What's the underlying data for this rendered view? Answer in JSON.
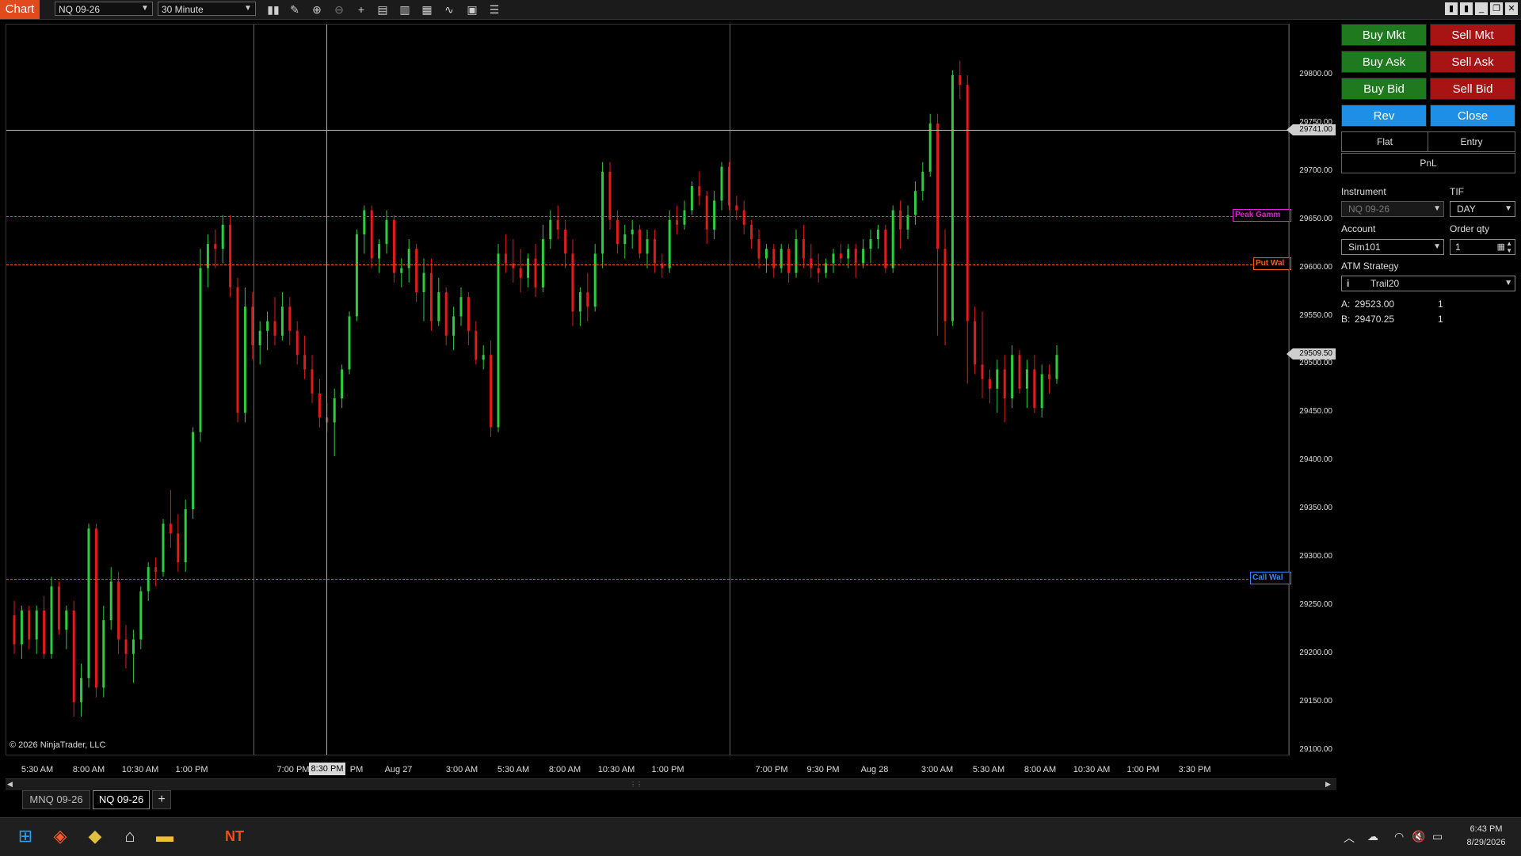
{
  "titlebar": {
    "app_title": "Chart",
    "instrument": "NQ 09-26",
    "interval": "30 Minute"
  },
  "chart": {
    "copyright": "© 2026 NinjaTrader, LLC",
    "y_ticks": [
      "29800.00",
      "29750.00",
      "29700.00",
      "29650.00",
      "29600.00",
      "29550.00",
      "29500.00",
      "29450.00",
      "29400.00",
      "29350.00",
      "29300.00",
      "29250.00",
      "29200.00",
      "29150.00",
      "29100.00"
    ],
    "x_labels": [
      "5:30 AM",
      "8:00 AM",
      "10:30 AM",
      "1:00 PM",
      "7:00 PM",
      "8:30 PM",
      "PM",
      "Aug 27",
      "3:00 AM",
      "5:30 AM",
      "8:00 AM",
      "10:30 AM",
      "1:00 PM",
      "7:00 PM",
      "9:30 PM",
      "Aug 28",
      "3:00 AM",
      "5:30 AM",
      "8:00 AM",
      "10:30 AM",
      "1:00 PM",
      "3:30 PM"
    ],
    "crosshair_price": "29741.00",
    "last_price": "29509.50",
    "levels": {
      "peak_gamma": {
        "label": "Peak Gamm",
        "price": 29653,
        "color": "#e01ee0"
      },
      "put_wall": {
        "label": "Put Wal",
        "price": 29603,
        "color": "#ff5a1e"
      },
      "call_wall": {
        "label": "Call Wal",
        "price": 29277,
        "color": "#2a8cff"
      }
    }
  },
  "chart_data": {
    "type": "candlestick",
    "ylim": [
      29100,
      29850
    ],
    "grid": false,
    "up_color": "#2ecc40",
    "down_color": "#e01b1b",
    "candles": [
      [
        29240,
        29255,
        29200,
        29210
      ],
      [
        29210,
        29250,
        29195,
        29245
      ],
      [
        29245,
        29250,
        29205,
        29215
      ],
      [
        29215,
        29250,
        29200,
        29245
      ],
      [
        29245,
        29260,
        29195,
        29200
      ],
      [
        29200,
        29280,
        29195,
        29270
      ],
      [
        29270,
        29275,
        29220,
        29225
      ],
      [
        29225,
        29250,
        29205,
        29245
      ],
      [
        29245,
        29255,
        29135,
        29150
      ],
      [
        29150,
        29190,
        29135,
        29175
      ],
      [
        29175,
        29335,
        29165,
        29330
      ],
      [
        29330,
        29335,
        29155,
        29165
      ],
      [
        29165,
        29250,
        29155,
        29235
      ],
      [
        29235,
        29290,
        29225,
        29275
      ],
      [
        29275,
        29285,
        29200,
        29215
      ],
      [
        29215,
        29230,
        29185,
        29200
      ],
      [
        29200,
        29225,
        29170,
        29215
      ],
      [
        29215,
        29270,
        29205,
        29265
      ],
      [
        29265,
        29295,
        29255,
        29290
      ],
      [
        29290,
        29300,
        29270,
        29285
      ],
      [
        29285,
        29340,
        29280,
        29335
      ],
      [
        29335,
        29370,
        29310,
        29325
      ],
      [
        29325,
        29345,
        29285,
        29295
      ],
      [
        29295,
        29360,
        29285,
        29350
      ],
      [
        29350,
        29435,
        29340,
        29430
      ],
      [
        29430,
        29620,
        29420,
        29600
      ],
      [
        29600,
        29635,
        29580,
        29625
      ],
      [
        29625,
        29640,
        29600,
        29620
      ],
      [
        29620,
        29655,
        29605,
        29645
      ],
      [
        29645,
        29655,
        29570,
        29580
      ],
      [
        29580,
        29590,
        29440,
        29450
      ],
      [
        29450,
        29580,
        29440,
        29560
      ],
      [
        29560,
        29575,
        29505,
        29520
      ],
      [
        29520,
        29545,
        29500,
        29535
      ],
      [
        29535,
        29555,
        29515,
        29545
      ],
      [
        29545,
        29570,
        29520,
        29530
      ],
      [
        29530,
        29575,
        29525,
        29560
      ],
      [
        29560,
        29570,
        29520,
        29535
      ],
      [
        29535,
        29545,
        29500,
        29510
      ],
      [
        29510,
        29530,
        29485,
        29495
      ],
      [
        29495,
        29510,
        29460,
        29470
      ],
      [
        29470,
        29485,
        29435,
        29445
      ],
      [
        29445,
        29460,
        29430,
        29440
      ],
      [
        29440,
        29475,
        29405,
        29465
      ],
      [
        29465,
        29500,
        29455,
        29495
      ],
      [
        29495,
        29555,
        29490,
        29550
      ],
      [
        29550,
        29640,
        29545,
        29635
      ],
      [
        29635,
        29665,
        29615,
        29660
      ],
      [
        29660,
        29665,
        29600,
        29610
      ],
      [
        29610,
        29630,
        29595,
        29625
      ],
      [
        29625,
        29660,
        29615,
        29650
      ],
      [
        29650,
        29655,
        29585,
        29595
      ],
      [
        29595,
        29610,
        29580,
        29600
      ],
      [
        29600,
        29630,
        29585,
        29620
      ],
      [
        29620,
        29625,
        29565,
        29575
      ],
      [
        29575,
        29610,
        29545,
        29595
      ],
      [
        29595,
        29610,
        29535,
        29545
      ],
      [
        29545,
        29590,
        29540,
        29575
      ],
      [
        29575,
        29580,
        29520,
        29530
      ],
      [
        29530,
        29560,
        29515,
        29550
      ],
      [
        29550,
        29580,
        29540,
        29570
      ],
      [
        29570,
        29575,
        29520,
        29535
      ],
      [
        29535,
        29545,
        29500,
        29505
      ],
      [
        29505,
        29520,
        29495,
        29510
      ],
      [
        29510,
        29525,
        29425,
        29435
      ],
      [
        29435,
        29625,
        29430,
        29615
      ],
      [
        29615,
        29635,
        29595,
        29605
      ],
      [
        29605,
        29630,
        29585,
        29600
      ],
      [
        29600,
        29620,
        29575,
        29590
      ],
      [
        29590,
        29615,
        29580,
        29610
      ],
      [
        29610,
        29625,
        29570,
        29580
      ],
      [
        29580,
        29645,
        29575,
        29630
      ],
      [
        29630,
        29660,
        29620,
        29650
      ],
      [
        29650,
        29665,
        29630,
        29640
      ],
      [
        29640,
        29650,
        29600,
        29615
      ],
      [
        29615,
        29630,
        29540,
        29555
      ],
      [
        29555,
        29580,
        29540,
        29575
      ],
      [
        29575,
        29595,
        29545,
        29560
      ],
      [
        29560,
        29625,
        29555,
        29615
      ],
      [
        29615,
        29710,
        29600,
        29700
      ],
      [
        29700,
        29710,
        29640,
        29650
      ],
      [
        29650,
        29660,
        29615,
        29625
      ],
      [
        29625,
        29645,
        29610,
        29635
      ],
      [
        29635,
        29650,
        29620,
        29640
      ],
      [
        29640,
        29645,
        29610,
        29615
      ],
      [
        29615,
        29640,
        29600,
        29630
      ],
      [
        29630,
        29640,
        29595,
        29605
      ],
      [
        29605,
        29615,
        29590,
        29600
      ],
      [
        29600,
        29660,
        29595,
        29650
      ],
      [
        29650,
        29665,
        29635,
        29645
      ],
      [
        29645,
        29670,
        29640,
        29660
      ],
      [
        29660,
        29690,
        29655,
        29685
      ],
      [
        29685,
        29700,
        29665,
        29675
      ],
      [
        29675,
        29680,
        29625,
        29640
      ],
      [
        29640,
        29680,
        29630,
        29670
      ],
      [
        29670,
        29710,
        29660,
        29705
      ],
      [
        29705,
        29710,
        29660,
        29665
      ],
      [
        29665,
        29675,
        29650,
        29660
      ],
      [
        29660,
        29670,
        29635,
        29645
      ],
      [
        29645,
        29650,
        29620,
        29630
      ],
      [
        29630,
        29640,
        29600,
        29610
      ],
      [
        29610,
        29625,
        29595,
        29620
      ],
      [
        29620,
        29625,
        29590,
        29600
      ],
      [
        29600,
        29625,
        29595,
        29620
      ],
      [
        29620,
        29625,
        29585,
        29595
      ],
      [
        29595,
        29640,
        29590,
        29630
      ],
      [
        29630,
        29645,
        29600,
        29610
      ],
      [
        29610,
        29625,
        29590,
        29600
      ],
      [
        29600,
        29615,
        29585,
        29595
      ],
      [
        29595,
        29610,
        29590,
        29605
      ],
      [
        29605,
        29620,
        29595,
        29615
      ],
      [
        29615,
        29625,
        29605,
        29610
      ],
      [
        29610,
        29625,
        29600,
        29620
      ],
      [
        29620,
        29625,
        29590,
        29605
      ],
      [
        29605,
        29630,
        29600,
        29620
      ],
      [
        29620,
        29640,
        29605,
        29630
      ],
      [
        29630,
        29645,
        29620,
        29640
      ],
      [
        29640,
        29645,
        29595,
        29600
      ],
      [
        29600,
        29665,
        29595,
        29660
      ],
      [
        29660,
        29670,
        29620,
        29640
      ],
      [
        29640,
        29665,
        29630,
        29655
      ],
      [
        29655,
        29690,
        29645,
        29680
      ],
      [
        29680,
        29710,
        29670,
        29700
      ],
      [
        29700,
        29760,
        29695,
        29750
      ],
      [
        29750,
        29760,
        29530,
        29620
      ],
      [
        29620,
        29640,
        29520,
        29545
      ],
      [
        29545,
        29805,
        29540,
        29800
      ],
      [
        29800,
        29815,
        29775,
        29790
      ],
      [
        29790,
        29800,
        29480,
        29545
      ],
      [
        29545,
        29560,
        29490,
        29500
      ],
      [
        29500,
        29555,
        29465,
        29485
      ],
      [
        29485,
        29495,
        29460,
        29475
      ],
      [
        29475,
        29505,
        29450,
        29495
      ],
      [
        29495,
        29510,
        29440,
        29465
      ],
      [
        29465,
        29520,
        29455,
        29510
      ],
      [
        29510,
        29515,
        29470,
        29475
      ],
      [
        29475,
        29505,
        29455,
        29495
      ],
      [
        29495,
        29510,
        29450,
        29455
      ],
      [
        29455,
        29500,
        29445,
        29490
      ],
      [
        29490,
        29500,
        29470,
        29485
      ],
      [
        29485,
        29520,
        29480,
        29510
      ]
    ]
  },
  "order_panel": {
    "buy_mkt": "Buy Mkt",
    "sell_mkt": "Sell Mkt",
    "buy_ask": "Buy Ask",
    "sell_ask": "Sell Ask",
    "buy_bid": "Buy Bid",
    "sell_bid": "Sell Bid",
    "rev": "Rev",
    "close": "Close",
    "flat": "Flat",
    "entry": "Entry",
    "pnl": "PnL",
    "instrument_label": "Instrument",
    "instrument_value": "NQ 09-26",
    "tif_label": "TIF",
    "tif_value": "DAY",
    "account_label": "Account",
    "account_value": "Sim101",
    "order_qty_label": "Order qty",
    "order_qty_value": "1",
    "atm_label": "ATM Strategy",
    "atm_value": "Trail20",
    "ask_label": "A:",
    "ask_price": "29523.00",
    "ask_qty": "1",
    "bid_label": "B:",
    "bid_price": "29470.25",
    "bid_qty": "1"
  },
  "tabs": [
    {
      "label": "MNQ 09-26"
    },
    {
      "label": "NQ 09-26"
    }
  ],
  "add_tab": "+",
  "taskbar": {
    "time": "6:43 PM",
    "date": "8/29/2026"
  }
}
